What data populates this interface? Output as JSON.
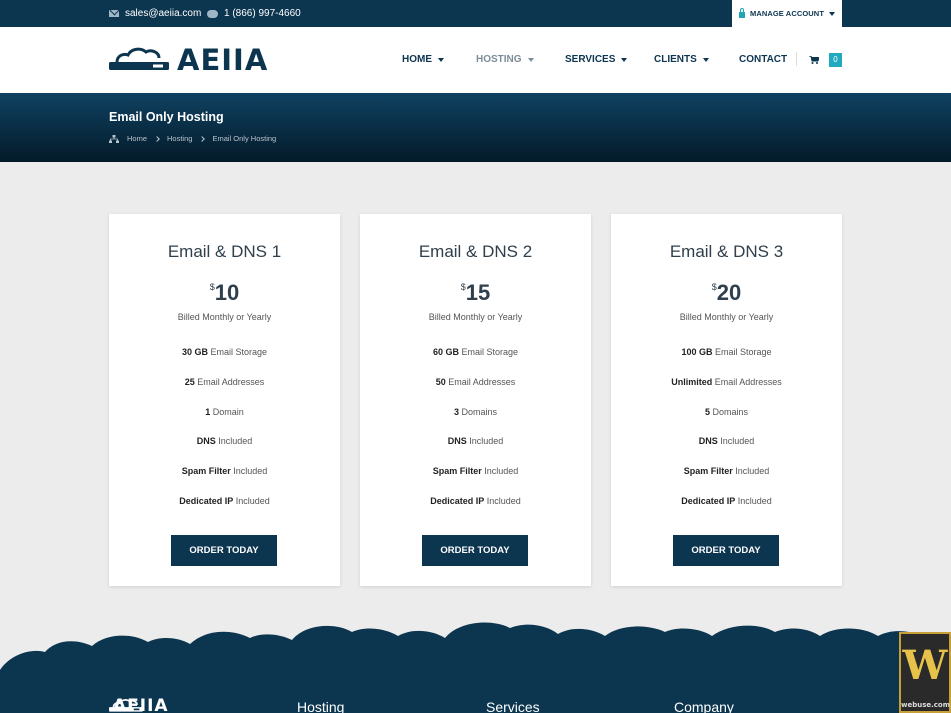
{
  "topbar": {
    "email": "sales@aeiia.com",
    "phone": "1 (866) 997-4660",
    "manage_account": "MANAGE ACCOUNT"
  },
  "brand": {
    "logo_text": "AEIIA",
    "logo_color": "#0c3550"
  },
  "nav": {
    "items": [
      {
        "label": "HOME",
        "has_dropdown": true
      },
      {
        "label": "HOSTING",
        "has_dropdown": true,
        "active": true
      },
      {
        "label": "SERVICES",
        "has_dropdown": true
      },
      {
        "label": "CLIENTS",
        "has_dropdown": true
      },
      {
        "label": "CONTACT",
        "has_dropdown": false
      }
    ],
    "cart_count": "0"
  },
  "banner": {
    "title": "Email Only Hosting",
    "breadcrumb": [
      "Home",
      "Hosting",
      "Email Only Hosting"
    ]
  },
  "plans": [
    {
      "name": "Email & DNS 1",
      "currency": "$",
      "price": "10",
      "billing": "Billed Monthly or Yearly",
      "features": [
        {
          "value": "30 GB",
          "text": "Email Storage"
        },
        {
          "value": "25",
          "text": "Email Addresses"
        },
        {
          "value": "1",
          "text": "Domain"
        },
        {
          "value": "DNS",
          "text": "Included"
        },
        {
          "value": "Spam Filter",
          "text": "Included"
        },
        {
          "value": "Dedicated IP",
          "text": "Included"
        }
      ],
      "button": "ORDER TODAY"
    },
    {
      "name": "Email & DNS 2",
      "currency": "$",
      "price": "15",
      "billing": "Billed Monthly or Yearly",
      "features": [
        {
          "value": "60 GB",
          "text": "Email Storage"
        },
        {
          "value": "50",
          "text": "Email Addresses"
        },
        {
          "value": "3",
          "text": "Domains"
        },
        {
          "value": "DNS",
          "text": "Included"
        },
        {
          "value": "Spam Filter",
          "text": "Included"
        },
        {
          "value": "Dedicated IP",
          "text": "Included"
        }
      ],
      "button": "ORDER TODAY"
    },
    {
      "name": "Email & DNS 3",
      "currency": "$",
      "price": "20",
      "billing": "Billed Monthly or Yearly",
      "features": [
        {
          "value": "100 GB",
          "text": "Email Storage"
        },
        {
          "value": "Unlimited",
          "text": "Email Addresses"
        },
        {
          "value": "5",
          "text": "Domains"
        },
        {
          "value": "DNS",
          "text": "Included"
        },
        {
          "value": "Spam Filter",
          "text": "Included"
        },
        {
          "value": "Dedicated IP",
          "text": "Included"
        }
      ],
      "button": "ORDER TODAY"
    }
  ],
  "footer": {
    "logo_text": "AEIIA",
    "columns": [
      "Hosting",
      "Services",
      "Company"
    ]
  },
  "watermark": {
    "glyph": "W",
    "text": "webuse.com"
  },
  "colors": {
    "primary": "#0c3550",
    "accent": "#22a9bd",
    "background": "#ececec"
  }
}
